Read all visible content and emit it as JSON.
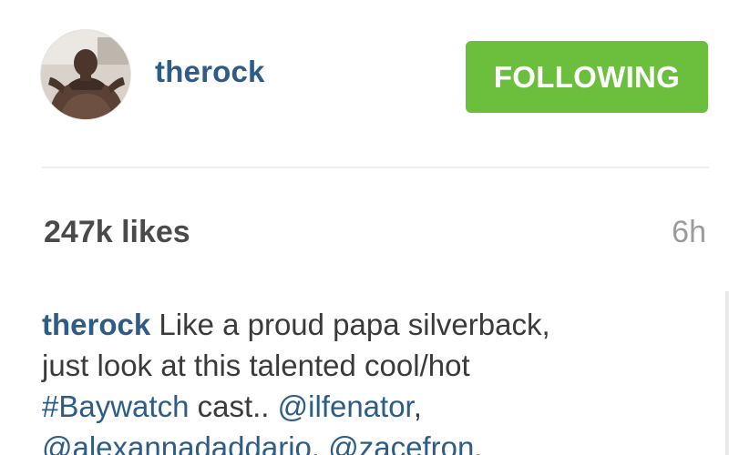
{
  "post": {
    "username": "therock",
    "follow_button_label": "FOLLOWING",
    "likes": "247k likes",
    "time_ago": "6h",
    "caption": {
      "author": "therock",
      "line1_text": " Like a proud papa silverback,",
      "line2_text": "just look at this talented cool/hot",
      "hashtag": "#Baywatch",
      "after_hashtag": " cast.. ",
      "mention1": "@ilfenator",
      "comma1": ",",
      "mention2": "@alexannadaddario",
      "comma2": ", ",
      "mention3": "@zacefron",
      "comma3": ","
    }
  },
  "colors": {
    "link": "#2d5d86",
    "follow_button": "#6bbf3d",
    "likes_text": "#4a4a4a",
    "time_text": "#9b9b9b"
  },
  "icons": {
    "avatar": "profile-photo"
  }
}
